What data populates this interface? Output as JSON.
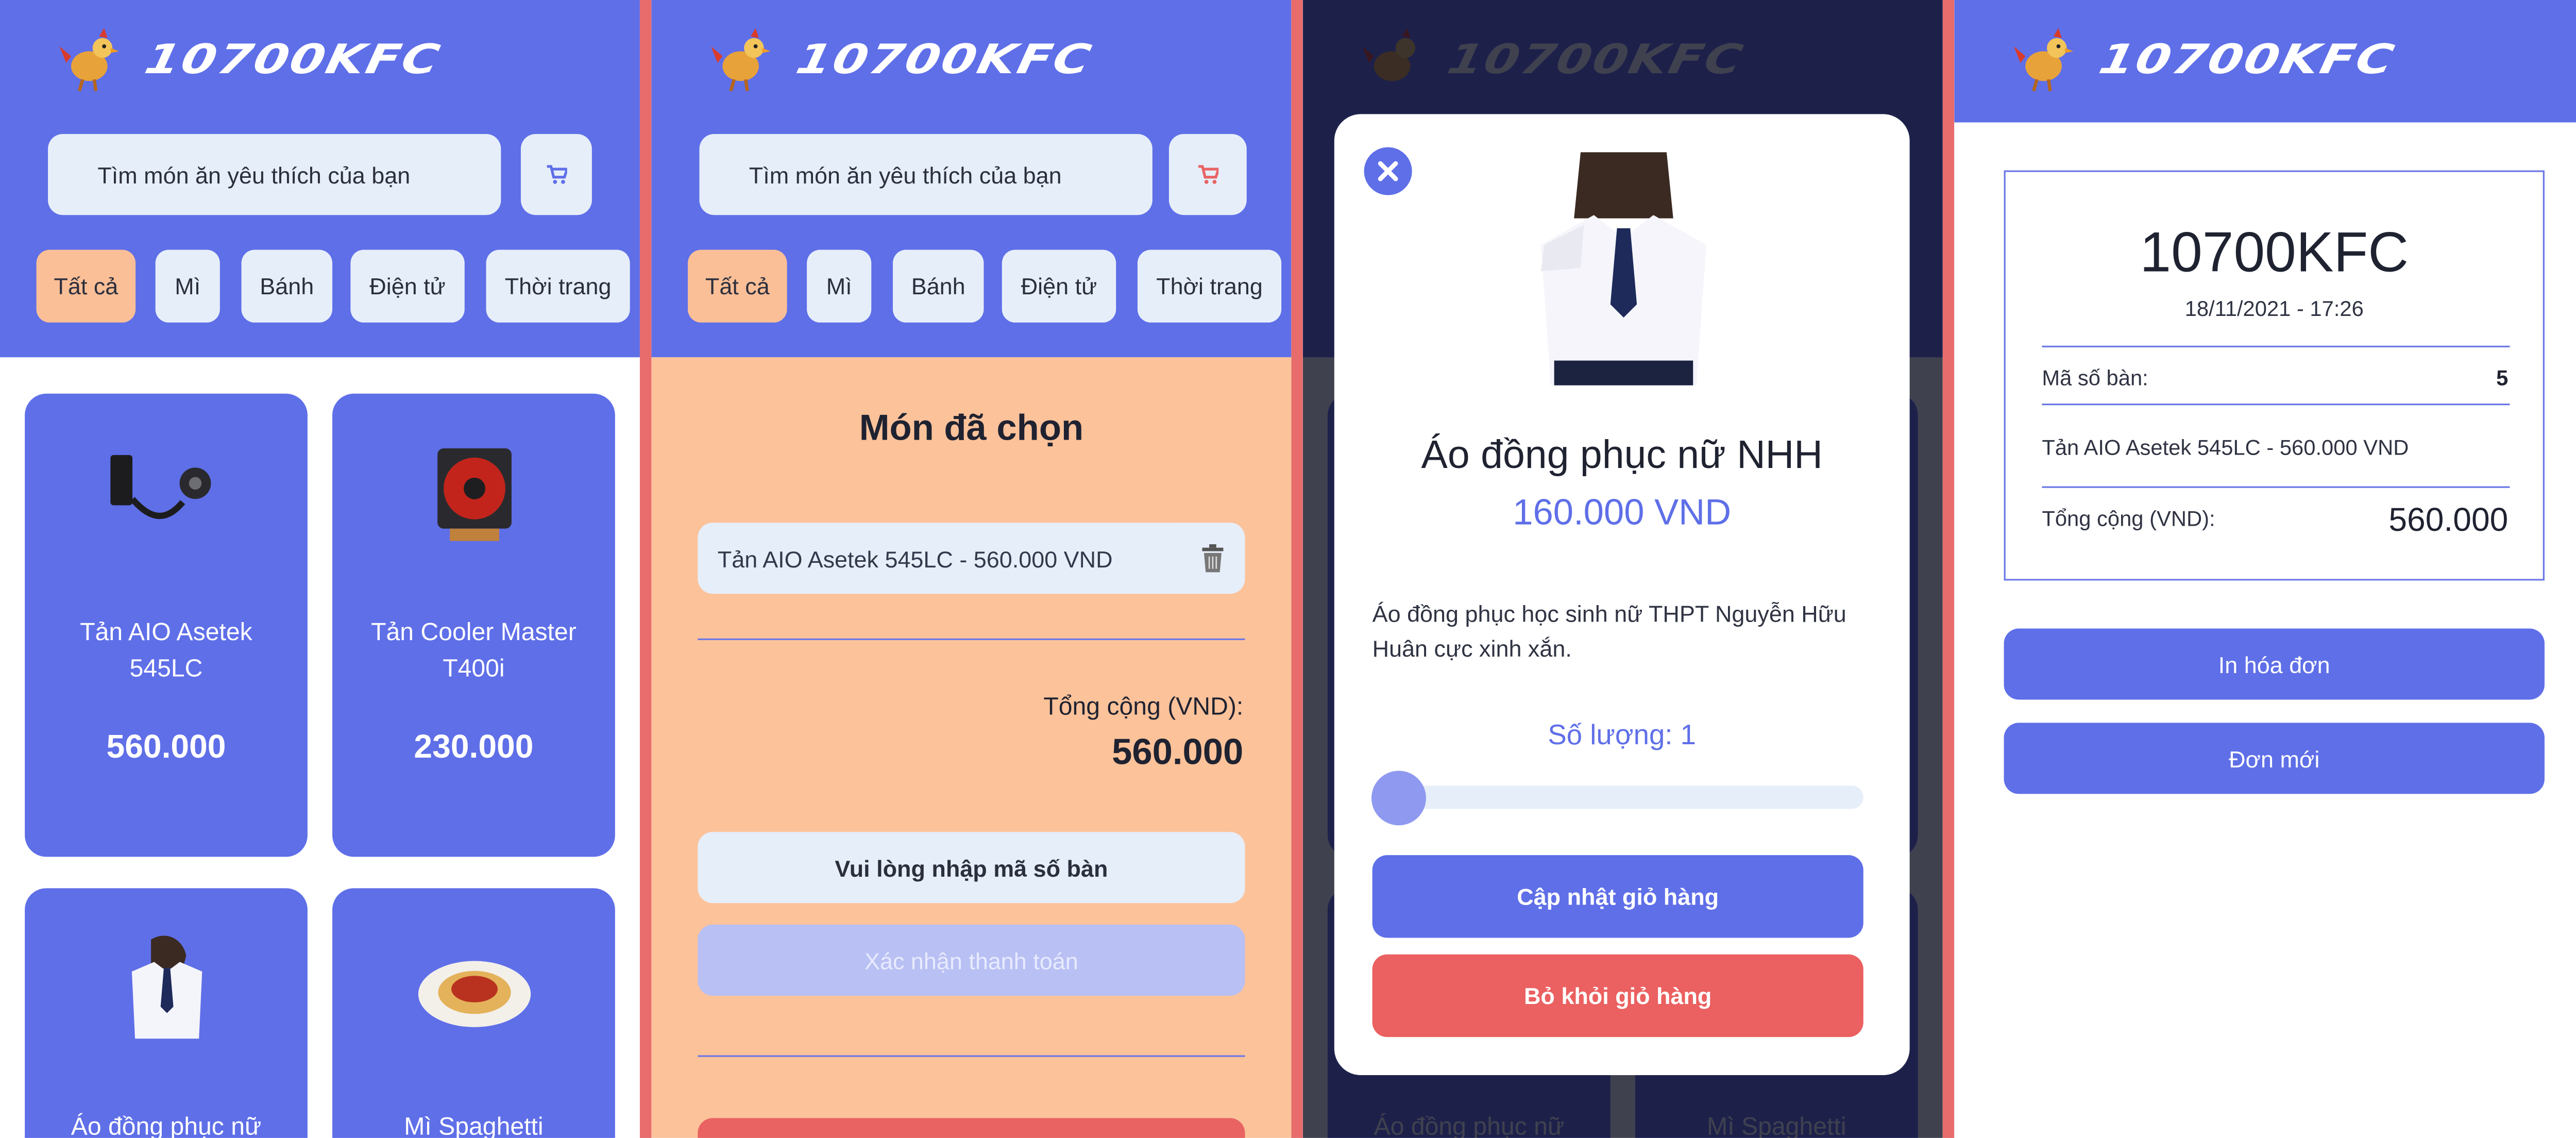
{
  "brand": {
    "logo_text": "10700KFC"
  },
  "colors": {
    "primary": "#5f6fe8",
    "peach": "#fcc29a",
    "danger": "#eb6060",
    "light": "#e6eefa"
  },
  "search": {
    "placeholder": "Tìm món ăn yêu thích của bạn"
  },
  "categories": [
    "Tất cả",
    "Mì",
    "Bánh",
    "Điện tử",
    "Thời trang"
  ],
  "products": [
    {
      "name": "Tản AIO Asetek 545LC",
      "price": "560.000",
      "icon": "aio-cooler-image"
    },
    {
      "name": "Tản Cooler Master T400i",
      "price": "230.000",
      "icon": "cpu-cooler-image"
    },
    {
      "name": "Áo đồng phục nữ",
      "price": "",
      "icon": "school-uniform-image"
    },
    {
      "name": "Mì Spaghetti",
      "price": "",
      "icon": "spaghetti-image"
    }
  ],
  "cart": {
    "title": "Món đã chọn",
    "items": [
      "Tản AIO Asetek 545LC - 560.000 VND"
    ],
    "total_label": "Tổng cộng (VND):",
    "total_value": "560.000",
    "table_placeholder": "Vui lòng nhập mã số bàn",
    "confirm_label": "Xác nhận thanh toán"
  },
  "modal": {
    "name": "Áo đồng phục nữ NHH",
    "price": "160.000 VND",
    "description": "Áo đồng phục học sinh nữ THPT Nguyễn Hữu Huân cực xinh xắn.",
    "quantity_label": "Số lượng: 1",
    "quantity_fraction": 0.0,
    "update_label": "Cập nhật giỏ hàng",
    "remove_label": "Bỏ khỏi giỏ hàng"
  },
  "receipt": {
    "title": "10700KFC",
    "datetime": "18/11/2021 - 17:26",
    "table_label": "Mã số bàn:",
    "table_value": "5",
    "item": "Tản AIO Asetek 545LC - 560.000 VND",
    "total_label": "Tổng cộng (VND):",
    "total_value": "560.000",
    "print_label": "In hóa đơn",
    "new_order_label": "Đơn mới"
  }
}
